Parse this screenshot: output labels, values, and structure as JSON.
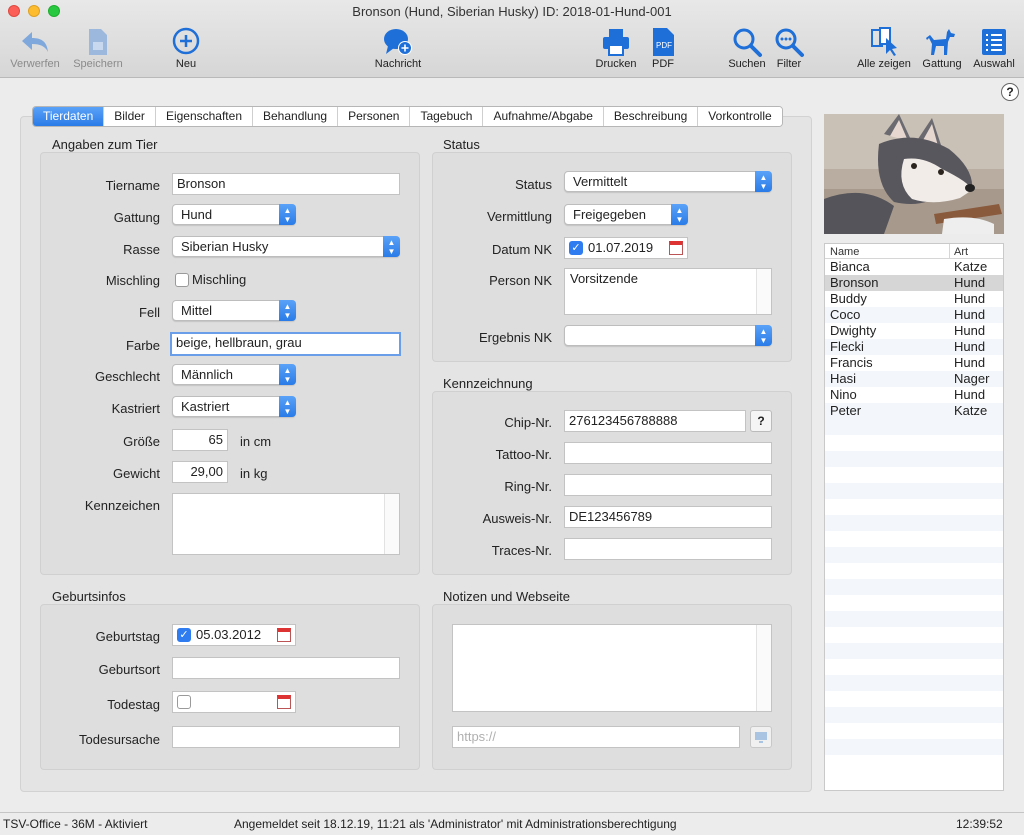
{
  "window": {
    "title": "Bronson (Hund, Siberian Husky) ID: 2018-01-Hund-001"
  },
  "toolbar": {
    "verwerfen": "Verwerfen",
    "speichern": "Speichern",
    "neu": "Neu",
    "nachricht": "Nachricht",
    "drucken": "Drucken",
    "pdf": "PDF",
    "suchen": "Suchen",
    "filter": "Filter",
    "alle_zeigen": "Alle zeigen",
    "gattung": "Gattung",
    "auswahl": "Auswahl",
    "pdf_badge": "PDF"
  },
  "help": "?",
  "tabs": [
    "Tierdaten",
    "Bilder",
    "Eigenschaften",
    "Behandlung",
    "Personen",
    "Tagebuch",
    "Aufnahme/Abgabe",
    "Beschreibung",
    "Vorkontrolle"
  ],
  "angaben": {
    "title": "Angaben zum Tier",
    "tiername_label": "Tiername",
    "tiername": "Bronson",
    "gattung_label": "Gattung",
    "gattung": "Hund",
    "rasse_label": "Rasse",
    "rasse": "Siberian Husky",
    "mischling_label": "Mischling",
    "mischling_cb": "Mischling",
    "fell_label": "Fell",
    "fell": "Mittel",
    "farbe_label": "Farbe",
    "farbe": "beige, hellbraun, grau",
    "geschlecht_label": "Geschlecht",
    "geschlecht": "Männlich",
    "kastriert_label": "Kastriert",
    "kastriert": "Kastriert",
    "groesse_label": "Größe",
    "groesse": "65",
    "groesse_unit": "in cm",
    "gewicht_label": "Gewicht",
    "gewicht": "29,00",
    "gewicht_unit": "in kg",
    "kennzeichen_label": "Kennzeichen"
  },
  "status": {
    "title": "Status",
    "status_label": "Status",
    "status": "Vermittelt",
    "vermittlung_label": "Vermittlung",
    "vermittlung": "Freigegeben",
    "datum_label": "Datum NK",
    "datum": "01.07.2019",
    "person_label": "Person NK",
    "person": "Vorsitzende",
    "ergebnis_label": "Ergebnis NK"
  },
  "kennz": {
    "title": "Kennzeichnung",
    "chip_label": "Chip-Nr.",
    "chip": "276123456788888",
    "chip_btn": "?",
    "tattoo_label": "Tattoo-Nr.",
    "ring_label": "Ring-Nr.",
    "ausweis_label": "Ausweis-Nr.",
    "ausweis": "DE123456789",
    "traces_label": "Traces-Nr."
  },
  "geburt": {
    "title": "Geburtsinfos",
    "geburtstag_label": "Geburtstag",
    "geburtstag": "05.03.2012",
    "geburtsort_label": "Geburtsort",
    "todestag_label": "Todestag",
    "todesursache_label": "Todesursache"
  },
  "notizen": {
    "title": "Notizen und Webseite",
    "url_placeholder": "https://"
  },
  "list": {
    "col_name": "Name",
    "col_art": "Art",
    "rows": [
      {
        "name": "Bianca",
        "art": "Katze"
      },
      {
        "name": "Bronson",
        "art": "Hund"
      },
      {
        "name": "Buddy",
        "art": "Hund"
      },
      {
        "name": "Coco",
        "art": "Hund"
      },
      {
        "name": "Dwighty",
        "art": "Hund"
      },
      {
        "name": "Flecki",
        "art": "Hund"
      },
      {
        "name": "Francis",
        "art": "Hund"
      },
      {
        "name": "Hasi",
        "art": "Nager"
      },
      {
        "name": "Nino",
        "art": "Hund"
      },
      {
        "name": "Peter",
        "art": "Katze"
      }
    ]
  },
  "statusbar": {
    "left": "TSV-Office - 36M - Aktiviert",
    "center": "Angemeldet seit 18.12.19, 11:21 als 'Administrator' mit Administrationsberechtigung",
    "time": "12:39:52"
  },
  "colors": {
    "accent": "#2a7be8",
    "toolbar_icon": "#1f6fd8"
  }
}
